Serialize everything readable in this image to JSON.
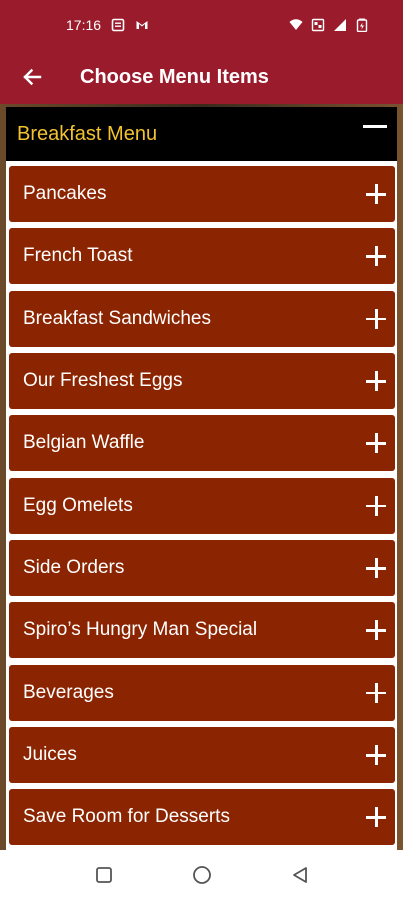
{
  "status_bar": {
    "time": "17:16",
    "icons": [
      "notes-icon",
      "gmail-icon",
      "wifi-icon",
      "data-icon",
      "signal-icon",
      "battery-icon"
    ]
  },
  "app_bar": {
    "title": "Choose Menu Items",
    "back_icon": "arrow-left-icon"
  },
  "section": {
    "title": "Breakfast Menu",
    "expanded": true
  },
  "menu_items": [
    {
      "label": "Pancakes"
    },
    {
      "label": "French Toast"
    },
    {
      "label": "Breakfast Sandwiches"
    },
    {
      "label": "Our Freshest Eggs"
    },
    {
      "label": "Belgian Waffle"
    },
    {
      "label": "Egg Omelets"
    },
    {
      "label": "Side Orders"
    },
    {
      "label": "Spiro’s Hungry Man Special"
    },
    {
      "label": "Beverages"
    },
    {
      "label": "Juices"
    },
    {
      "label": "Save Room for Desserts"
    }
  ],
  "nav_bar": {
    "buttons": [
      "recents-icon",
      "home-icon",
      "back-icon"
    ]
  },
  "colors": {
    "brand": "#9a1c2c",
    "item_bg": "#8b2400",
    "section_title": "#f2c230"
  }
}
